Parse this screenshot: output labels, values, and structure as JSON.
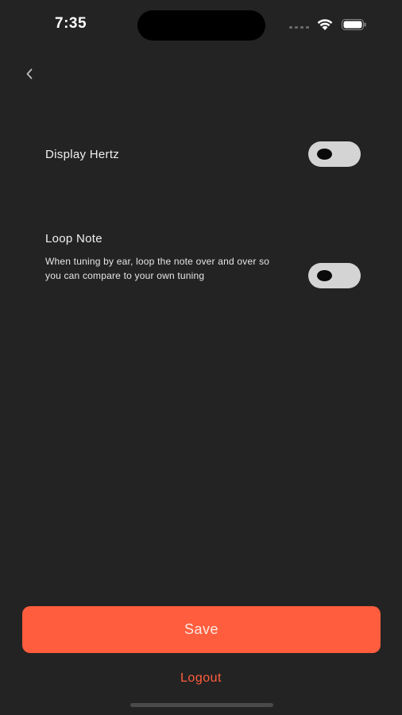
{
  "status_bar": {
    "time": "7:35"
  },
  "nav": {
    "back_icon": "chevron-left-icon"
  },
  "settings": {
    "display_hertz": {
      "label": "Display Hertz",
      "enabled": false
    },
    "loop_note": {
      "label": "Loop Note",
      "description": "When tuning by ear, loop the note over and over so you can compare to your own tuning",
      "enabled": false
    }
  },
  "actions": {
    "save_label": "Save",
    "logout_label": "Logout"
  },
  "colors": {
    "background": "#232323",
    "accent": "#ff5d3d",
    "toggle_track": "#d4d4d4"
  }
}
